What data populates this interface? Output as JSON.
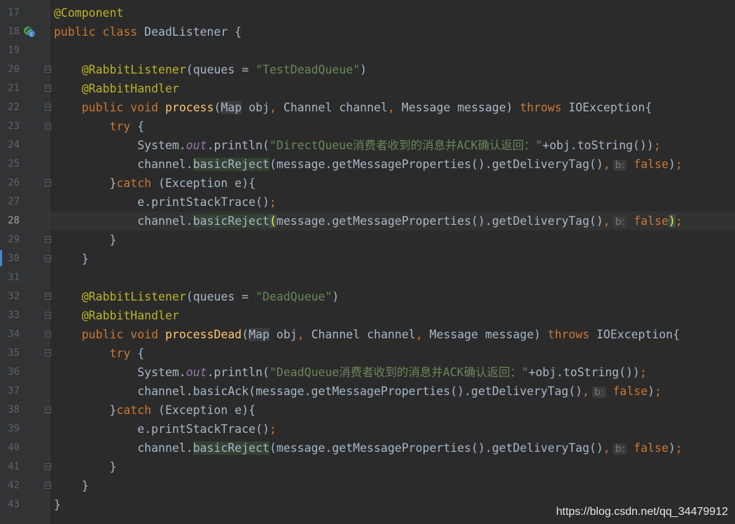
{
  "editor": {
    "watermark": "https://blog.csdn.net/qq_34479912",
    "lines": [
      {
        "n": "17",
        "t": [
          [
            "an",
            "@Component"
          ]
        ]
      },
      {
        "n": "18",
        "t": [
          [
            "kw",
            "public "
          ],
          [
            "kw",
            "class "
          ],
          [
            "",
            "DeadListener {"
          ]
        ]
      },
      {
        "n": "19",
        "t": []
      },
      {
        "n": "20",
        "t": [
          [
            "",
            "    "
          ],
          [
            "an",
            "@RabbitListener"
          ],
          [
            "",
            "(queues = "
          ],
          [
            "str",
            "\"TestDeadQueue\""
          ],
          [
            "",
            ")"
          ]
        ]
      },
      {
        "n": "21",
        "t": [
          [
            "",
            "    "
          ],
          [
            "an",
            "@RabbitHandler"
          ]
        ]
      },
      {
        "n": "22",
        "t": [
          [
            "",
            "    "
          ],
          [
            "kw",
            "public "
          ],
          [
            "kw",
            "void "
          ],
          [
            "fn",
            "process"
          ],
          [
            "",
            "("
          ],
          [
            "hlm",
            "Map"
          ],
          [
            "",
            " obj"
          ],
          [
            "kw",
            ", "
          ],
          [
            "",
            "Channel channel"
          ],
          [
            "kw",
            ", "
          ],
          [
            "",
            "Message message) "
          ],
          [
            "kw",
            "throws "
          ],
          [
            "",
            "IOException{"
          ]
        ]
      },
      {
        "n": "23",
        "t": [
          [
            "",
            "        "
          ],
          [
            "kw",
            "try "
          ],
          [
            "",
            "{"
          ]
        ]
      },
      {
        "n": "24",
        "t": [
          [
            "",
            "            System."
          ],
          [
            "fld",
            "out"
          ],
          [
            "",
            ".println("
          ],
          [
            "str",
            "\"DirectQueue消费者收到的消息并ACK确认返回：\""
          ],
          [
            "",
            "+obj.toString())"
          ],
          [
            "kw",
            ";"
          ]
        ]
      },
      {
        "n": "25",
        "t": [
          [
            "",
            "            channel."
          ],
          [
            "hl",
            "basicReject"
          ],
          [
            "",
            "(message.getMessageProperties().getDeliveryTag()"
          ],
          [
            "kw",
            ","
          ],
          [
            "hint",
            "b:"
          ],
          [
            "kw",
            " false"
          ],
          [
            "",
            ")"
          ],
          [
            "kw",
            ";"
          ]
        ]
      },
      {
        "n": "26",
        "t": [
          [
            "",
            "        }"
          ],
          [
            "kw",
            "catch "
          ],
          [
            "",
            "(Exception e){"
          ]
        ]
      },
      {
        "n": "27",
        "t": [
          [
            "",
            "            e.printStackTrace()"
          ],
          [
            "kw",
            ";"
          ]
        ]
      },
      {
        "n": "28",
        "t": [
          [
            "",
            "            channel."
          ],
          [
            "hl",
            "basicReject"
          ],
          [
            "br",
            "("
          ],
          [
            "",
            "message.getMessageProperties().getDeliveryTag()"
          ],
          [
            "kw",
            ","
          ],
          [
            "hint",
            "b:"
          ],
          [
            "kw",
            " false"
          ],
          [
            "br",
            ")"
          ],
          [
            "kw",
            ";"
          ]
        ]
      },
      {
        "n": "29",
        "t": [
          [
            "",
            "        }"
          ]
        ]
      },
      {
        "n": "30",
        "t": [
          [
            "",
            "    }"
          ]
        ]
      },
      {
        "n": "31",
        "t": []
      },
      {
        "n": "32",
        "t": [
          [
            "",
            "    "
          ],
          [
            "an",
            "@RabbitListener"
          ],
          [
            "",
            "(queues = "
          ],
          [
            "str",
            "\"DeadQueue\""
          ],
          [
            "",
            ")"
          ]
        ]
      },
      {
        "n": "33",
        "t": [
          [
            "",
            "    "
          ],
          [
            "an",
            "@RabbitHandler"
          ]
        ]
      },
      {
        "n": "34",
        "t": [
          [
            "",
            "    "
          ],
          [
            "kw",
            "public "
          ],
          [
            "kw",
            "void "
          ],
          [
            "fn",
            "processDead"
          ],
          [
            "",
            "("
          ],
          [
            "hlm",
            "Map"
          ],
          [
            "",
            " obj"
          ],
          [
            "kw",
            ", "
          ],
          [
            "",
            "Channel channel"
          ],
          [
            "kw",
            ", "
          ],
          [
            "",
            "Message message) "
          ],
          [
            "kw",
            "throws "
          ],
          [
            "",
            "IOException{"
          ]
        ]
      },
      {
        "n": "35",
        "t": [
          [
            "",
            "        "
          ],
          [
            "kw",
            "try "
          ],
          [
            "",
            "{"
          ]
        ]
      },
      {
        "n": "36",
        "t": [
          [
            "",
            "            System."
          ],
          [
            "fld",
            "out"
          ],
          [
            "",
            ".println("
          ],
          [
            "str",
            "\"DeadQueue消费者收到的消息并ACK确认返回：\""
          ],
          [
            "",
            "+obj.toString())"
          ],
          [
            "kw",
            ";"
          ]
        ]
      },
      {
        "n": "37",
        "t": [
          [
            "",
            "            channel.basicAck(message.getMessageProperties().getDeliveryTag()"
          ],
          [
            "kw",
            ","
          ],
          [
            "hint",
            "b:"
          ],
          [
            "kw",
            " false"
          ],
          [
            "",
            ")"
          ],
          [
            "kw",
            ";"
          ]
        ]
      },
      {
        "n": "38",
        "t": [
          [
            "",
            "        }"
          ],
          [
            "kw",
            "catch "
          ],
          [
            "",
            "(Exception e){"
          ]
        ]
      },
      {
        "n": "39",
        "t": [
          [
            "",
            "            e.printStackTrace()"
          ],
          [
            "kw",
            ";"
          ]
        ]
      },
      {
        "n": "40",
        "t": [
          [
            "",
            "            channel."
          ],
          [
            "hl",
            "basicReject"
          ],
          [
            "",
            "(message.getMessageProperties().getDeliveryTag()"
          ],
          [
            "kw",
            ","
          ],
          [
            "hint",
            "b:"
          ],
          [
            "kw",
            " false"
          ],
          [
            "",
            ")"
          ],
          [
            "kw",
            ";"
          ]
        ]
      },
      {
        "n": "41",
        "t": [
          [
            "",
            "        }"
          ]
        ]
      },
      {
        "n": "42",
        "t": [
          [
            "",
            "    }"
          ]
        ]
      },
      {
        "n": "43",
        "t": [
          [
            "",
            "}"
          ]
        ]
      }
    ],
    "folds": [
      "20",
      "21",
      "22",
      "23",
      "26",
      "29",
      "30",
      "32",
      "33",
      "34",
      "35",
      "38",
      "41",
      "42"
    ],
    "current_line": "28",
    "bean_icon_line": "18",
    "colors": {
      "background": "#2b2b2b",
      "keyword": "#cc7832",
      "annotation": "#bbb529",
      "string": "#6a8759",
      "method": "#ffc66d"
    }
  }
}
